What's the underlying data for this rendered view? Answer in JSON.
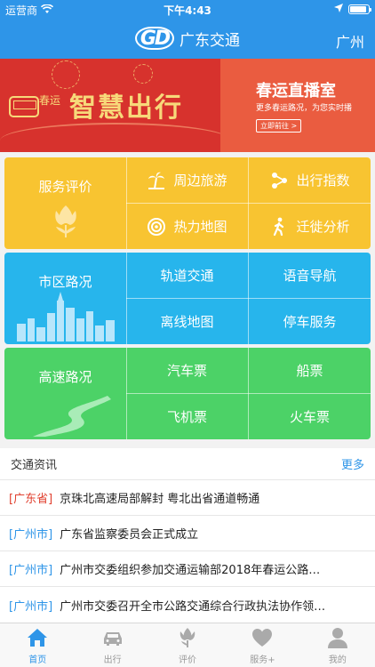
{
  "status": {
    "carrier": "运营商",
    "time": "下午4:43"
  },
  "nav": {
    "logo": "GD",
    "title": "广东交通",
    "city": "广州"
  },
  "banner": {
    "left_title": "智慧出行",
    "left_sub": "春运",
    "right_title": "春运直播室",
    "right_desc": "更多春运路况，为您实时播",
    "right_button": "立即前往 >"
  },
  "grid": {
    "row1": {
      "big": "服务评价",
      "cells": [
        "周边旅游",
        "出行指数",
        "热力地图",
        "迁徙分析"
      ]
    },
    "row2": {
      "big": "市区路况",
      "cells": [
        "轨道交通",
        "语音导航",
        "离线地图",
        "停车服务"
      ]
    },
    "row3": {
      "big": "高速路况",
      "cells": [
        "汽车票",
        "船票",
        "飞机票",
        "火车票"
      ]
    }
  },
  "news": {
    "title": "交通资讯",
    "more": "更多",
    "items": [
      {
        "tag": "[广东省]",
        "text": "京珠北高速局部解封 粤北出省通道畅通"
      },
      {
        "tag": "[广州市]",
        "text": "广东省监察委员会正式成立"
      },
      {
        "tag": "[广州市]",
        "text": "广州市交委组织参加交通运输部2018年春运公路…"
      },
      {
        "tag": "[广州市]",
        "text": "广州市交委召开全市公路交通综合行政执法协作领…"
      }
    ]
  },
  "tabs": [
    "首页",
    "出行",
    "评价",
    "服务+",
    "我的"
  ],
  "colors": {
    "primary": "#2e95e8",
    "yellow": "#f8c431",
    "cyan": "#27b5ec",
    "green": "#4cd267",
    "red": "#e0402f"
  },
  "icons": {
    "status": [
      "wifi-icon",
      "location-arrow-icon",
      "battery-icon"
    ],
    "grid": [
      "tulip-icon",
      "palm-tree-icon",
      "share-nodes-icon",
      "heat-map-icon",
      "walking-person-icon",
      "city-skyline-icon",
      "winding-road-icon"
    ],
    "tabs": [
      "home-icon",
      "car-icon",
      "tulip-icon",
      "heart-icon",
      "person-icon"
    ]
  }
}
